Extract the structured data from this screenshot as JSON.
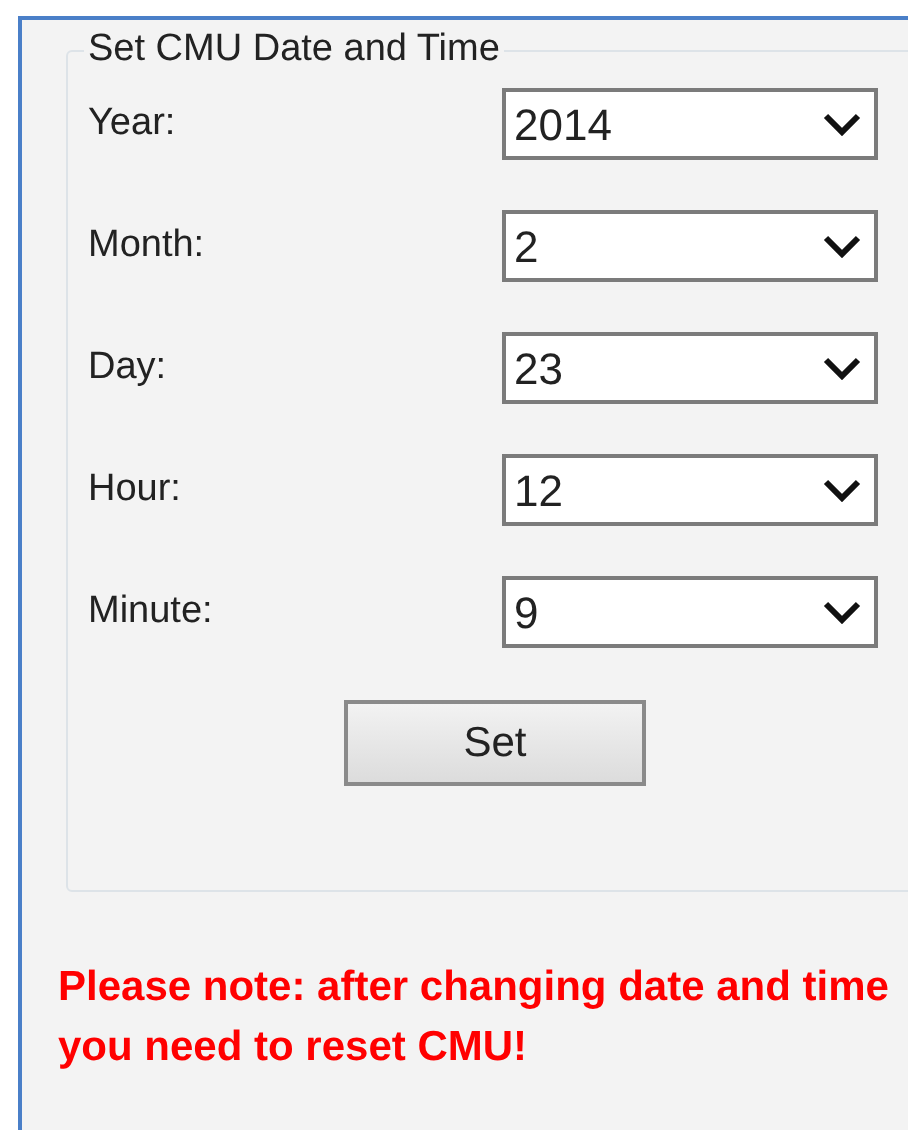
{
  "group": {
    "title": "Set CMU Date and Time",
    "fields": [
      {
        "label": "Year:",
        "value": "2014"
      },
      {
        "label": "Month:",
        "value": "2"
      },
      {
        "label": "Day:",
        "value": "23"
      },
      {
        "label": "Hour:",
        "value": "12"
      },
      {
        "label": "Minute:",
        "value": "9"
      }
    ],
    "button": "Set"
  },
  "note": "Please note: after changing date and time you need to reset CMU!"
}
